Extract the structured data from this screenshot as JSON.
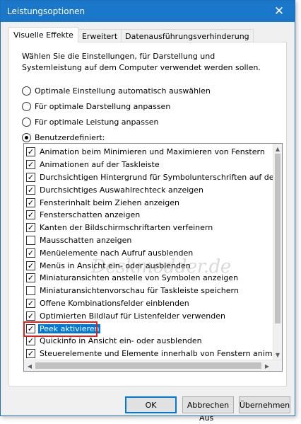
{
  "window": {
    "title": "Leistungsoptionen",
    "close_glyph": "✕"
  },
  "tabs": [
    {
      "label": "Visuelle Effekte",
      "active": true
    },
    {
      "label": "Erweitert",
      "active": false
    },
    {
      "label": "Datenausführungsverhinderung",
      "active": false
    }
  ],
  "intro_text": "Wählen Sie die Einstellungen, für Darstellung und Systemleistung auf dem Computer verwendet werden sollen.",
  "options": [
    {
      "label": "Optimale Einstellung automatisch auswählen",
      "checked": false
    },
    {
      "label": "Für optimale Darstellung anpassen",
      "checked": false
    },
    {
      "label": "Für optimale Leistung anpassen",
      "checked": false
    },
    {
      "label": "Benutzerdefiniert:",
      "checked": true
    }
  ],
  "effects": [
    {
      "label": "Animation beim Minimieren und Maximieren von Fenstern",
      "checked": true
    },
    {
      "label": "Animationen auf der Taskleiste",
      "checked": true
    },
    {
      "label": "Durchsichtigen Hintergrund für Symbolunterschriften auf dem De",
      "checked": true
    },
    {
      "label": "Durchsichtiges Auswahlrechteck anzeigen",
      "checked": true
    },
    {
      "label": "Fensterinhalt beim Ziehen anzeigen",
      "checked": true
    },
    {
      "label": "Fensterschatten anzeigen",
      "checked": true
    },
    {
      "label": "Kanten der Bildschirmschriftarten verfeinern",
      "checked": true
    },
    {
      "label": "Mausschatten anzeigen",
      "checked": false
    },
    {
      "label": "Menüelemente nach Aufruf ausblenden",
      "checked": true
    },
    {
      "label": "Menüs in Ansicht ein- oder ausblenden",
      "checked": true
    },
    {
      "label": "Miniaturansichten anstelle von Symbolen anzeigen",
      "checked": true
    },
    {
      "label": "Miniaturansichtenvorschau für Taskleiste speichern",
      "checked": false
    },
    {
      "label": "Offene Kombinationsfelder einblenden",
      "checked": true
    },
    {
      "label": "Optimierten Bildlauf für Listenfelder verwenden",
      "checked": true
    },
    {
      "label": "Peek aktivieren",
      "checked": true,
      "focused": true
    },
    {
      "label": "Quickinfo in Ansicht ein- oder ausblenden",
      "checked": true
    },
    {
      "label": "Steuerelemente und Elemente innerhalb von Fenstern animieren",
      "checked": true
    }
  ],
  "watermark": "Deskmodder.de",
  "buttons": {
    "ok": "OK",
    "cancel": "Abbrechen",
    "apply": "Übernehmen"
  },
  "background_fragments": {
    "bottom": "Aus"
  },
  "colors": {
    "titlebar": "#1a77c9",
    "highlight": "#e0201b",
    "selection": "#0078d7"
  }
}
